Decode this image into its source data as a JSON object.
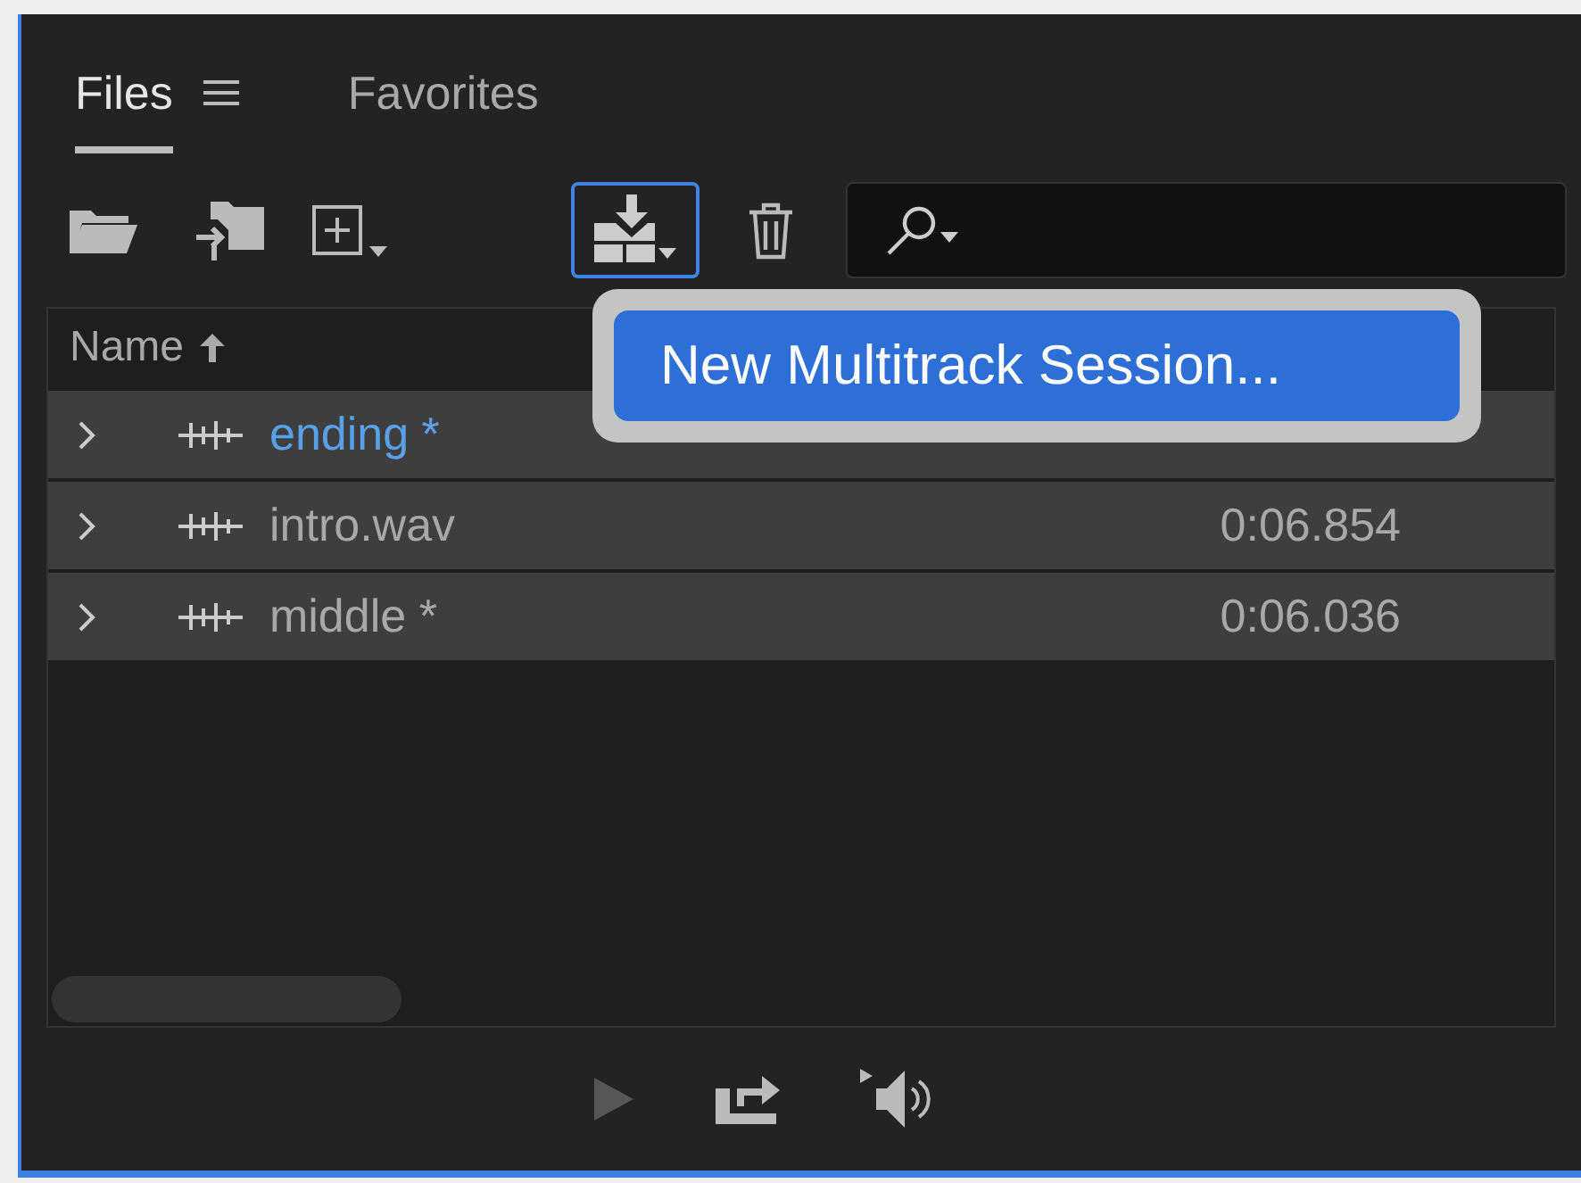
{
  "tabs": [
    {
      "label": "Files",
      "selected": true
    },
    {
      "label": "Favorites",
      "selected": false
    }
  ],
  "table": {
    "columns": [
      "Name"
    ],
    "rows": [
      {
        "name": "ending *",
        "selected": true
      },
      {
        "name": "intro.wav",
        "duration": "0:06.854",
        "selected": false
      },
      {
        "name": "middle *",
        "duration": "0:06.036",
        "selected": false
      }
    ]
  },
  "menu": {
    "items": [
      {
        "label": "New Multitrack Session...",
        "selected": true
      }
    ]
  }
}
